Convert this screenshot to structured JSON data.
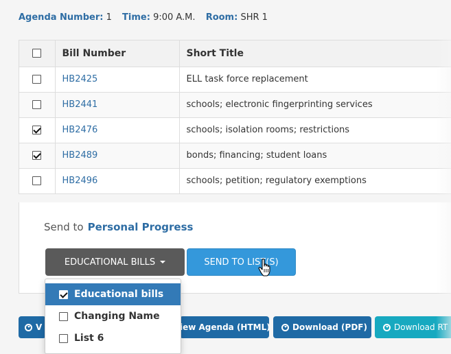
{
  "agenda": {
    "number_label": "Agenda Number:",
    "number_value": "1",
    "time_label": "Time:",
    "time_value": "9:00 A.M.",
    "room_label": "Room:",
    "room_value": "SHR 1"
  },
  "table": {
    "headers": [
      "Bill Number",
      "Short Title"
    ],
    "rows": [
      {
        "bill": "HB2425",
        "title": "ELL task force replacement",
        "checked": false
      },
      {
        "bill": "HB2441",
        "title": "schools; electronic fingerprinting services",
        "checked": false
      },
      {
        "bill": "HB2476",
        "title": "schools; isolation rooms; restrictions",
        "checked": true
      },
      {
        "bill": "HB2489",
        "title": "bonds; financing; student loans",
        "checked": true
      },
      {
        "bill": "HB2496",
        "title": "schools; petition; regulatory exemptions",
        "checked": false
      }
    ]
  },
  "send": {
    "label": "Send to",
    "target": "Personal Progress",
    "dropdown_label": "EDUCATIONAL BILLS",
    "send_button": "SEND TO LIST(S)"
  },
  "dropdown": {
    "items": [
      {
        "label": "Educational bills",
        "checked": true
      },
      {
        "label": "Changing Name",
        "checked": false
      },
      {
        "label": "List 6",
        "checked": false
      }
    ]
  },
  "bottom_buttons": {
    "view_clipped": "V",
    "view_agenda_html": "iew Agenda (HTML)",
    "download_pdf": "Download (PDF)",
    "download_rtf": "Download RT"
  },
  "colors": {
    "link": "#2e6da4",
    "primary": "#3498db",
    "dark_button": "#5a5a5a",
    "menu_active": "#337ab7",
    "teal_button": "#17a9c0"
  }
}
